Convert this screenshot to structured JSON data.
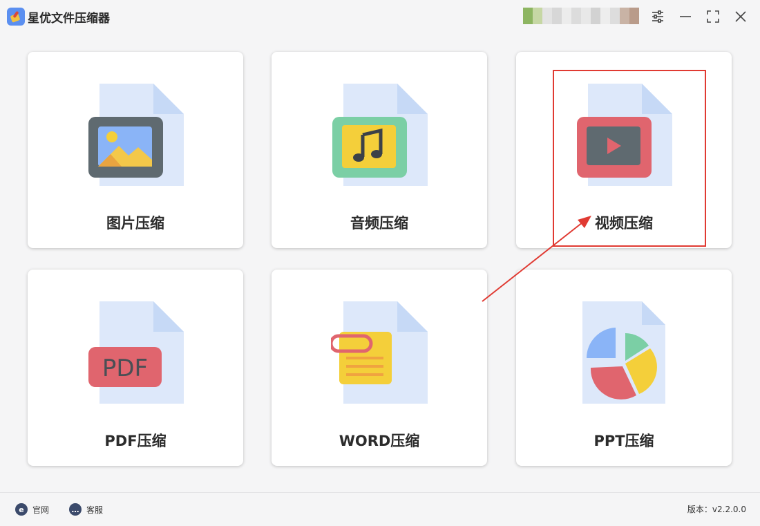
{
  "app": {
    "title": "星优文件压缩器"
  },
  "window_controls": {
    "settings_icon": "sliders-icon",
    "minimize_icon": "minimize-icon",
    "maximize_icon": "maximize-icon",
    "close_icon": "close-icon"
  },
  "cards": [
    {
      "label": "图片压缩",
      "icon": "image-file-icon"
    },
    {
      "label": "音频压缩",
      "icon": "audio-file-icon"
    },
    {
      "label": "视频压缩",
      "icon": "video-file-icon"
    },
    {
      "label": "PDF压缩",
      "icon": "pdf-file-icon"
    },
    {
      "label": "WORD压缩",
      "icon": "word-file-icon"
    },
    {
      "label": "PPT压缩",
      "icon": "ppt-file-icon"
    }
  ],
  "annotation": {
    "highlight_color": "#e03a32"
  },
  "footer": {
    "website_label": "官网",
    "support_label": "客服",
    "version_text": "版本：v2.2.0.0"
  },
  "colors": {
    "accent": "#5b8ff0",
    "background": "#f5f5f6"
  }
}
